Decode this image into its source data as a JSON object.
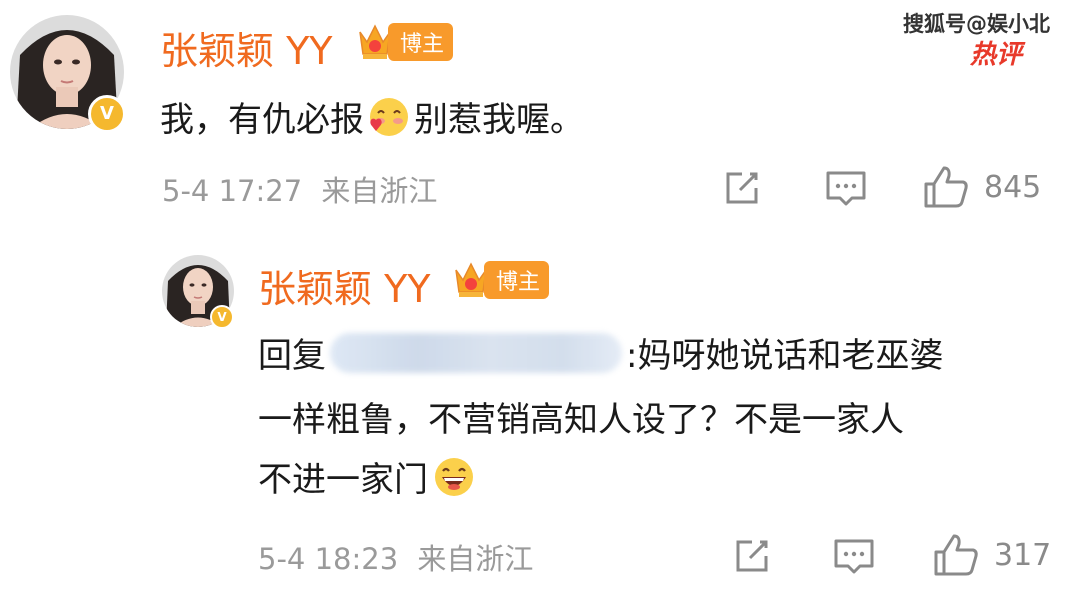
{
  "watermark": {
    "source": "搜狐号@娱小北",
    "tag": "热评"
  },
  "comment": {
    "author": "张颖颖 YY",
    "badge_label": "博主",
    "verified_mark": "V",
    "text_before_emoji": "我，有仇必报",
    "text_after_emoji": "别惹我喔。",
    "emoji": "blush-heart-emoji",
    "timestamp": "5-4 17:27",
    "location": "来自浙江",
    "like_count": "845"
  },
  "reply": {
    "author": "张颖颖 YY",
    "badge_label": "博主",
    "verified_mark": "V",
    "reply_prefix": "回复",
    "line1_rest": ":妈呀她说话和老巫婆",
    "line2": "一样粗鲁，不营销高知人设了？不是一家人",
    "line3": "不进一家门",
    "emoji": "grinning-emoji",
    "timestamp": "5-4 18:23",
    "location": "来自浙江",
    "like_count": "317"
  },
  "icons": {
    "share": "share-icon",
    "comment": "comment-icon",
    "like": "thumbs-up-icon"
  },
  "colors": {
    "author": "#f06a1f",
    "badge": "#f89a2b",
    "verified": "#f5b82e",
    "meta": "#9a9a9a",
    "watermark_tag": "#e8392a"
  }
}
